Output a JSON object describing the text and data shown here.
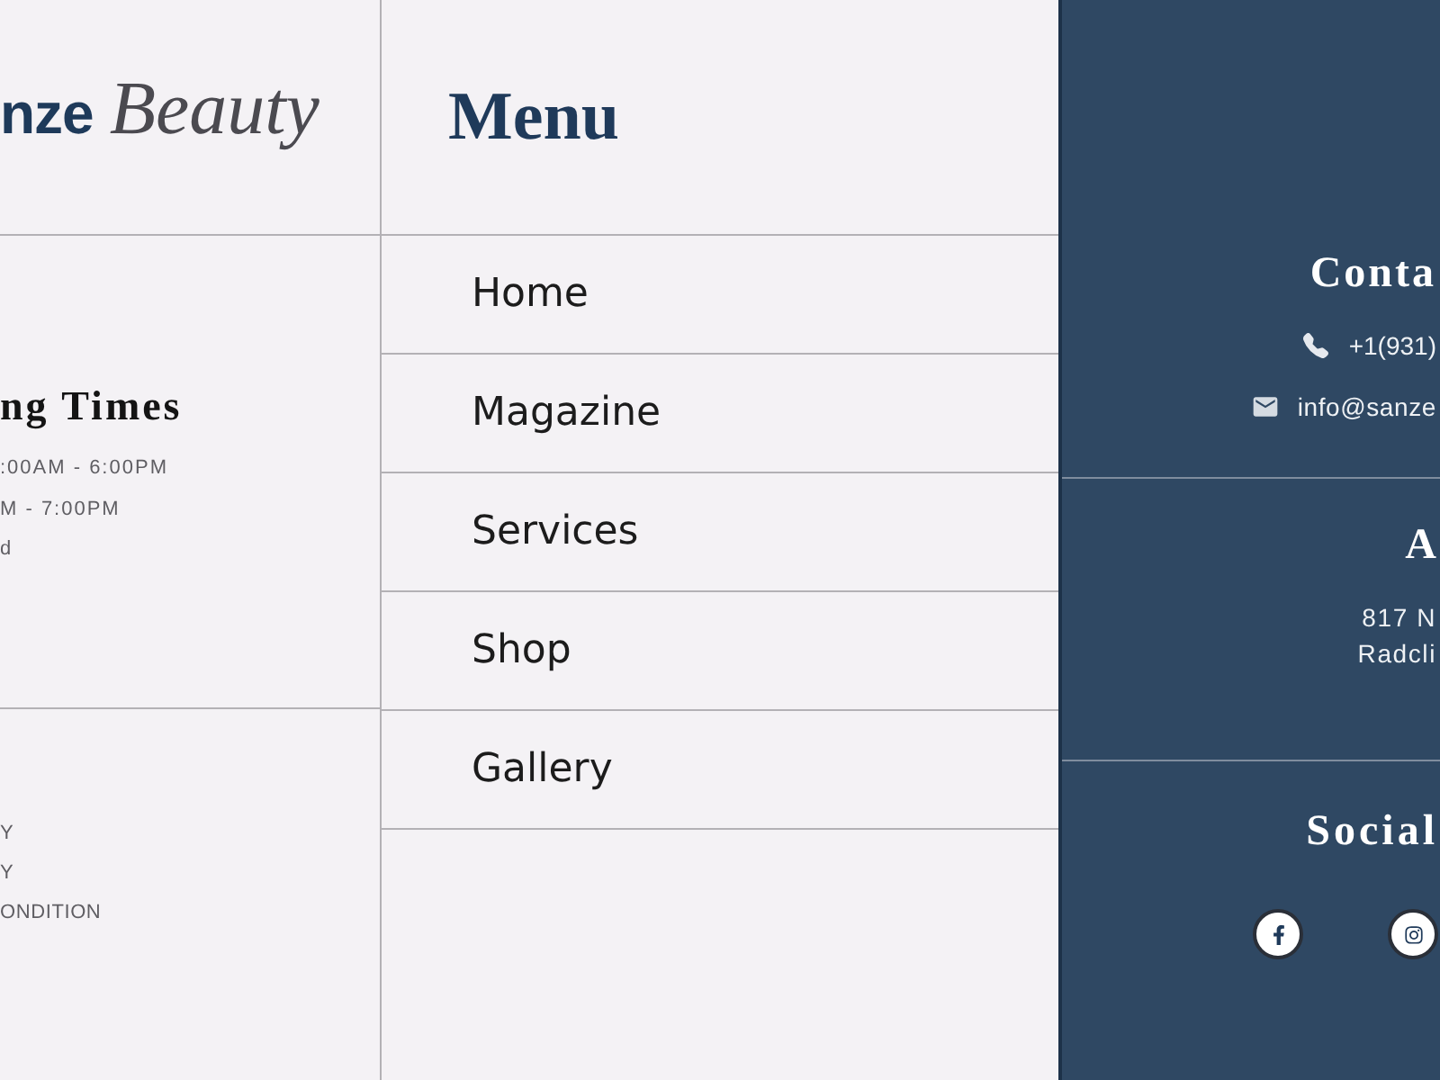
{
  "logo": {
    "brand": "nze",
    "tagline": "Beauty"
  },
  "hours": {
    "title": "ng Times",
    "lines": [
      ":00AM - 6:00PM",
      "M - 7:00PM",
      "d"
    ]
  },
  "footer_links": [
    "Y",
    "Y",
    "ONDITION"
  ],
  "menu": {
    "title": "Menu",
    "items": [
      "Home",
      "Magazine",
      "Services",
      "Shop",
      "Gallery"
    ]
  },
  "contact": {
    "title": "Conta",
    "phone": "+1(931)",
    "email": "info@sanze"
  },
  "address": {
    "title": "A",
    "lines": [
      "817 N",
      "Radcli"
    ]
  },
  "social": {
    "title": "Social",
    "links": [
      {
        "kind": "facebook"
      },
      {
        "kind": "instagram"
      }
    ]
  }
}
